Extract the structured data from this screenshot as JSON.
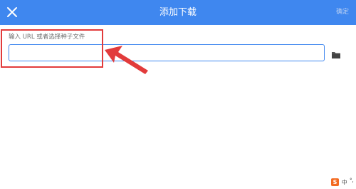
{
  "appbar": {
    "title": "添加下载",
    "confirm_label": "确定",
    "close_icon": "close-icon"
  },
  "form": {
    "url_label": "输入 URL 或者选择种子文件",
    "url_value": "",
    "folder_icon": "folder-icon"
  },
  "ime": {
    "logo": "S",
    "mode": "中",
    "extra": "°,"
  },
  "colors": {
    "accent": "#3f87ef",
    "annotation": "#e23b3b",
    "ime_brand": "#f36a21"
  }
}
